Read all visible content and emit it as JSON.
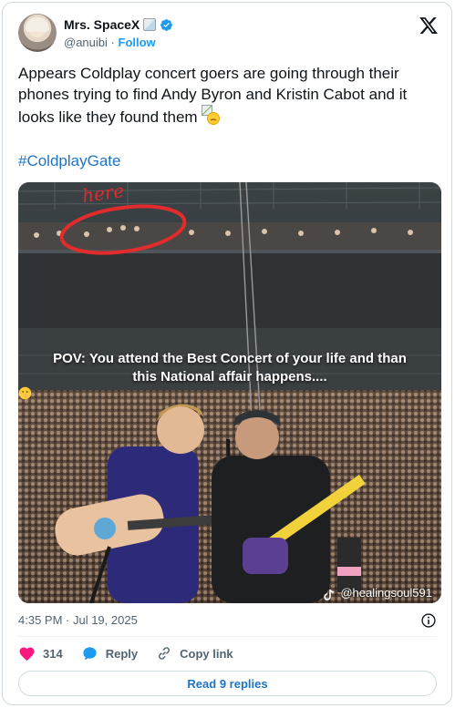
{
  "author": {
    "display_name": "Mrs. SpaceX",
    "handle": "@anuibi",
    "separator": "·",
    "follow_label": "Follow"
  },
  "tweet": {
    "text": "Appears Coldplay concert goers are going through their phones trying to find Andy Byron and Kristin Cabot and it looks like they found them",
    "hashtag": "#ColdplayGate"
  },
  "media": {
    "annotation": "here",
    "caption_line1": "POV: You attend the Best Concert of your life and than",
    "caption_line2": "this National affair happens....",
    "watermark": "@healingsoul591"
  },
  "meta": {
    "timestamp": "4:35 PM · Jul 19, 2025"
  },
  "actions": {
    "likes_count": "314",
    "reply_label": "Reply",
    "copy_link_label": "Copy link"
  },
  "read_replies_label": "Read 9 replies",
  "colors": {
    "accent": "#1d9bf0",
    "link": "#1d74c4",
    "heart": "#f91880",
    "muted": "#536471"
  },
  "icons": [
    "verified-icon",
    "x-logo-icon",
    "info-icon",
    "heart-icon",
    "reply-icon",
    "link-icon",
    "tiktok-icon",
    "shushing-face-icon"
  ]
}
